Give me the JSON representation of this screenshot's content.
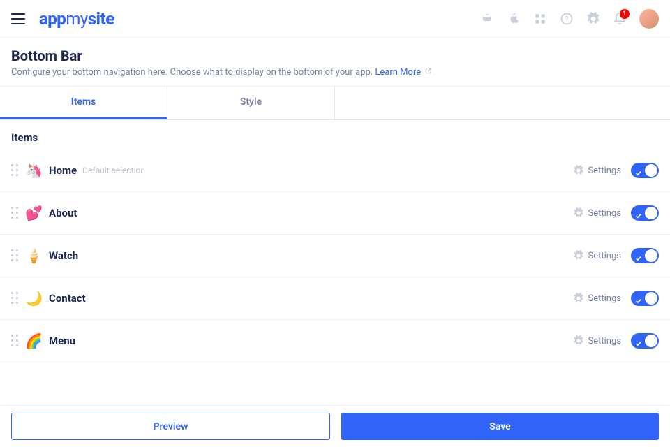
{
  "header": {
    "logo_app": "app",
    "logo_my": "my",
    "logo_site": "site",
    "notif_count": "1"
  },
  "page": {
    "title": "Bottom Bar",
    "description": "Configure your bottom navigation here. Choose what to display on the bottom of your app. ",
    "learn_more": "Learn More"
  },
  "tabs": {
    "items": "Items",
    "style": "Style"
  },
  "section": {
    "title": "Items"
  },
  "items": [
    {
      "label": "Home",
      "sub": "Default selection",
      "emoji": "🦄"
    },
    {
      "label": "About",
      "sub": "",
      "emoji": "💕"
    },
    {
      "label": "Watch",
      "sub": "",
      "emoji": "🍦"
    },
    {
      "label": "Contact",
      "sub": "",
      "emoji": "🌙"
    },
    {
      "label": "Menu",
      "sub": "",
      "emoji": "🌈"
    }
  ],
  "row_settings_label": "Settings",
  "footer": {
    "preview": "Preview",
    "save": "Save"
  }
}
